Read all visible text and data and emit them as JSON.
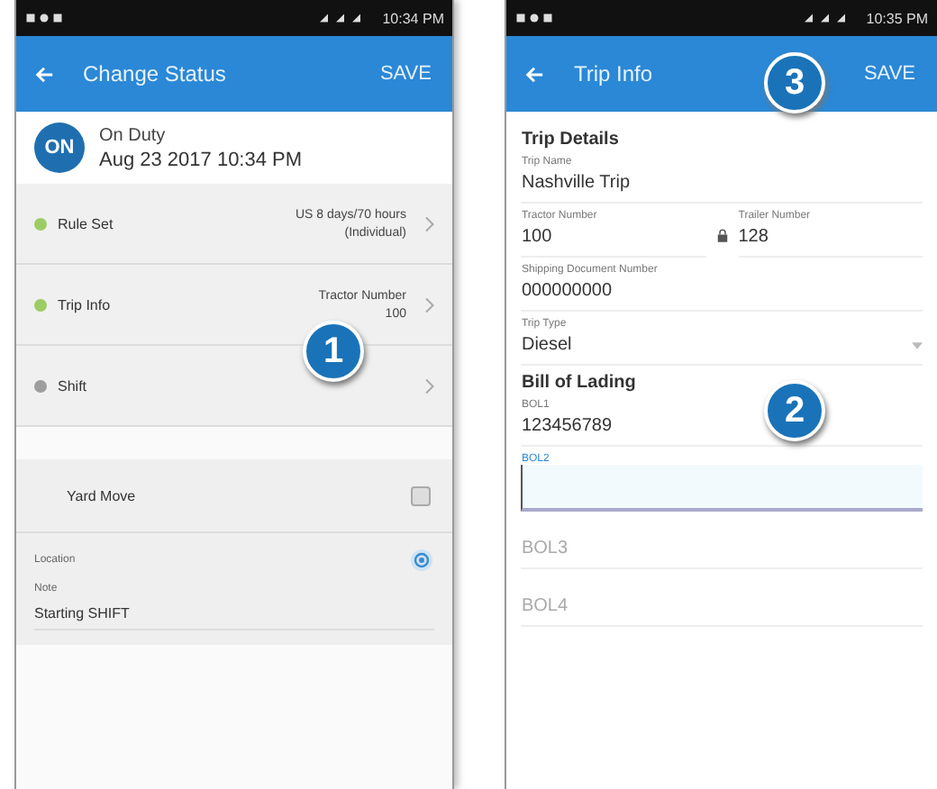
{
  "callouts": [
    {
      "number": "1"
    },
    {
      "number": "2"
    },
    {
      "number": "3"
    }
  ],
  "left_screen": {
    "status_bar": {
      "time": "10:34 PM"
    },
    "app_bar": {
      "title": "Change Status",
      "action": "SAVE"
    },
    "status": {
      "avatar": "ON",
      "name": "On Duty",
      "datetime": "Aug 23 2017 10:34 PM"
    },
    "rows": [
      {
        "label": "Rule Set",
        "color": "#9ccc65",
        "value": "US 8 days/70 hours",
        "value_2": "(Individual)"
      },
      {
        "label": "Trip Info",
        "color": "#9ccc65",
        "value": "Tractor Number",
        "value_2": "100"
      },
      {
        "label": "Shift",
        "color": "#9e9e9e"
      }
    ],
    "yard_move": {
      "label": "Yard Move",
      "on": false
    },
    "location": {
      "label": "Location",
      "note_label": "Note",
      "note": "Starting SHIFT"
    }
  },
  "right_screen": {
    "status_bar": {
      "time": "10:35 PM"
    },
    "app_bar": {
      "title": "Trip Info",
      "action": "SAVE"
    },
    "trip_details": {
      "heading": "Trip Details",
      "trip_name_label": "Trip Name",
      "trip_name": "Nashville Trip",
      "tractor_label": "Tractor Number",
      "tractor": "100",
      "trailer_label": "Trailer Number",
      "trailer": "128",
      "shipping_label": "Shipping Document Number",
      "shipping": "000000000",
      "trip_type_label": "Trip Type",
      "trip_type": "Diesel"
    },
    "bill_of_lading": {
      "heading": "Bill of Lading",
      "fields": [
        {
          "label": "BOL1",
          "value": "123456789",
          "focused": false
        },
        {
          "label": "BOL2",
          "focused": true
        },
        {
          "placeholder": "BOL3",
          "focused": false
        },
        {
          "placeholder": "BOL4",
          "focused": false
        }
      ]
    }
  }
}
